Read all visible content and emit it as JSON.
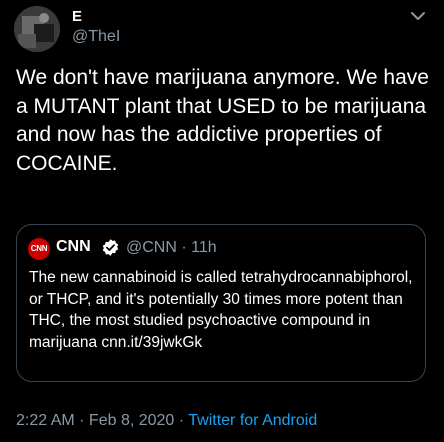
{
  "tweet": {
    "display_name": "E",
    "handle": "@TheI",
    "text": "We don't have marijuana anymore. We have a MUTANT plant that USED to be marijuana and now has the addictive properties of COCAINE.",
    "more_icon": "chevron-down-icon"
  },
  "quoted_tweet": {
    "logo_text": "CNN",
    "name": "CNN",
    "verified_icon": "verified-badge-icon",
    "meta": "@CNN · 11h",
    "text": "The new cannabinoid is called tetrahydrocannabiphorol, or THCP, and it's potentially 30 times more potent than THC, the most studied psychoactive compound in marijuana cnn.it/39jwkGk"
  },
  "footer": {
    "time": "2:22 AM",
    "date": "Feb 8, 2020",
    "separator": " · ",
    "app": "Twitter for Android"
  },
  "colors": {
    "background": "#000000",
    "text_primary": "#ffffff",
    "text_secondary": "#8899a6",
    "link": "#1da1f2",
    "border": "#38444d",
    "cnn_red": "#cc0000"
  }
}
